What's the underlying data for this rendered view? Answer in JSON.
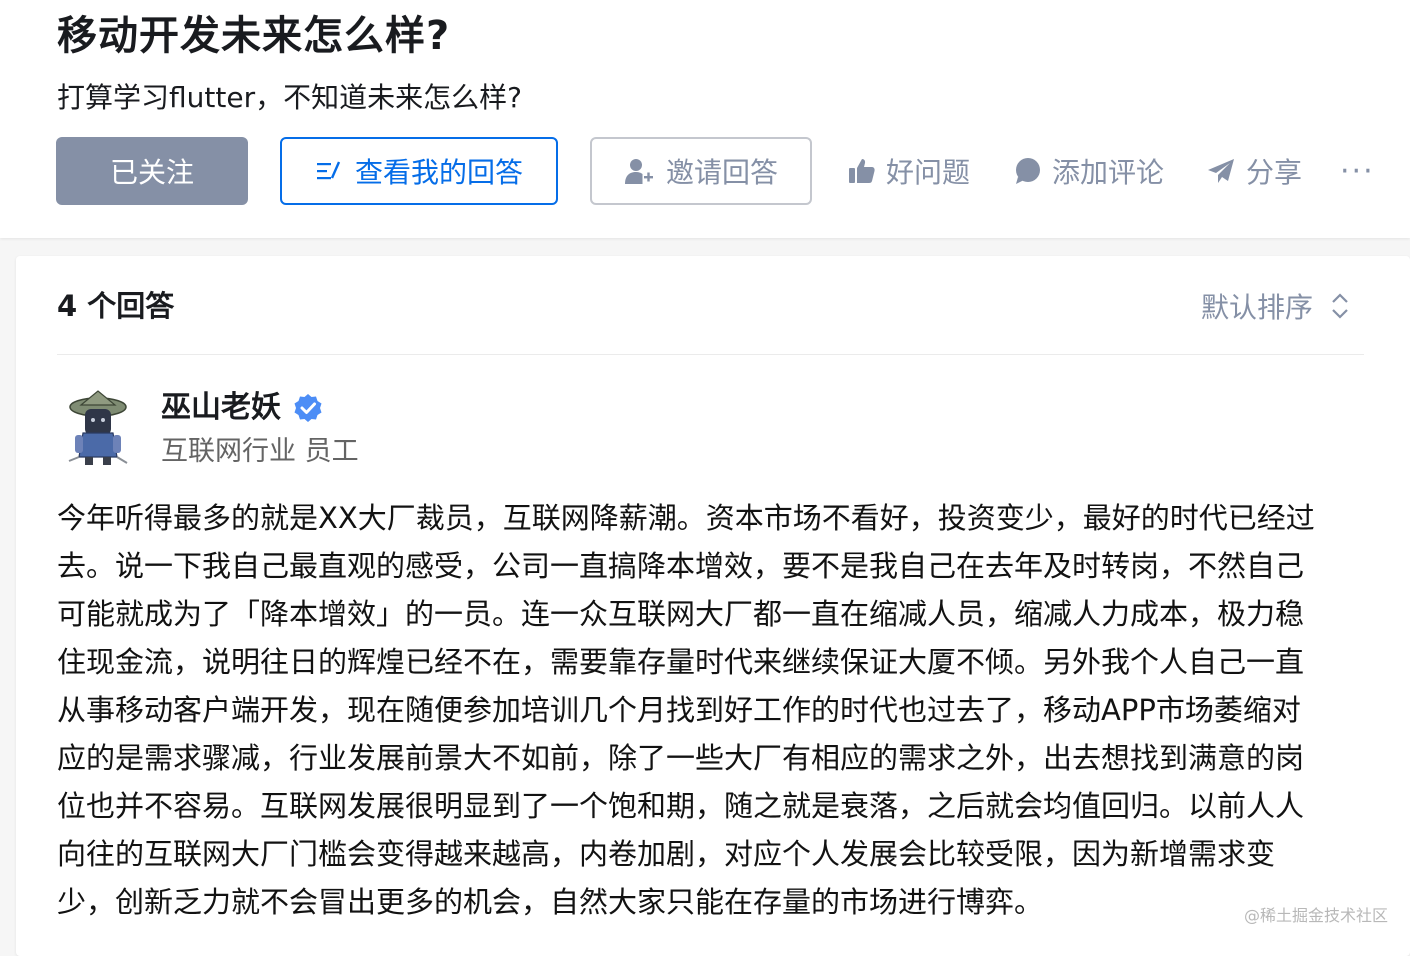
{
  "question": {
    "title": "移动开发未来怎么样?",
    "detail": "打算学习flutter，不知道未来怎么样?"
  },
  "actions": {
    "followed_label": "已关注",
    "view_answer_label": "查看我的回答",
    "invite_label": "邀请回答",
    "good_question_label": "好问题",
    "add_comment_label": "添加评论",
    "share_label": "分享",
    "more_label": "···"
  },
  "answers": {
    "count_label": "4 个回答",
    "sort_label": "默认排序",
    "items": [
      {
        "author": {
          "name": "巫山老妖",
          "headline": "互联网行业 员工",
          "verified": true
        },
        "content_lines": [
          "今年听得最多的就是XX大厂裁员，互联网降薪潮。资本市场不看好，投资变少，最好的时代已经过",
          "去。说一下我自己最直观的感受，公司一直搞降本增效，要不是我自己在去年及时转岗，不然自己",
          "可能就成为了「降本增效」的一员。连一众互联网大厂都一直在缩减人员，缩减人力成本，极力稳",
          "住现金流，说明往日的辉煌已经不在，需要靠存量时代来继续保证大厦不倾。另外我个人自己一直",
          "从事移动客户端开发，现在随便参加培训几个月找到好工作的时代也过去了，移动APP市场萎缩对",
          "应的是需求骤减，行业发展前景大不如前，除了一些大厂有相应的需求之外，出去想找到满意的岗",
          "位也并不容易。互联网发展很明显到了一个饱和期，随之就是衰落，之后就会均值回归。以前人人",
          "向往的互联网大厂门槛会变得越来越高，内卷加剧，对应个人发展会比较受限，因为新增需求变",
          "少，创新乏力就不会冒出更多的机会，自然大家只能在存量的市场进行博弈。"
        ]
      }
    ]
  },
  "watermark": "@稀土掘金技术社区",
  "colors": {
    "accent": "#056de8",
    "muted": "#8590a6",
    "followed_bg": "#8590a6",
    "text": "#121212"
  },
  "icons": {
    "view_answer": "edit-list-icon",
    "invite": "add-user-icon",
    "good_question": "thumbs-up-icon",
    "add_comment": "comment-bubble-icon",
    "share": "paper-plane-icon",
    "sort": "sort-chevrons-icon",
    "verified": "verified-badge-icon"
  }
}
